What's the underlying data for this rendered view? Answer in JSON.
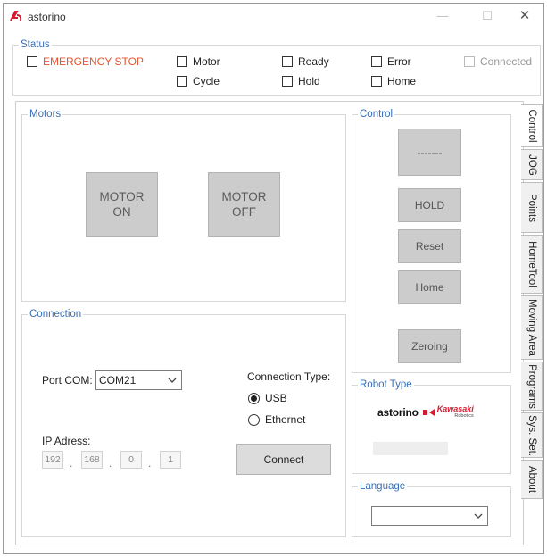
{
  "window": {
    "title": "astorino",
    "minimize": "—",
    "maximize": "☐",
    "close": "✕"
  },
  "status": {
    "legend": "Status",
    "emergency_stop": "EMERGENCY STOP",
    "motor": "Motor",
    "cycle": "Cycle",
    "ready": "Ready",
    "hold": "Hold",
    "error": "Error",
    "home": "Home",
    "connected": "Connected"
  },
  "motors": {
    "legend": "Motors",
    "on_line1": "MOTOR",
    "on_line2": "ON",
    "off_line1": "MOTOR",
    "off_line2": "OFF"
  },
  "control": {
    "legend": "Control",
    "top_button": "-------",
    "hold": "HOLD",
    "reset": "Reset",
    "home": "Home",
    "zeroing": "Zeroing"
  },
  "connection": {
    "legend": "Connection",
    "port_label": "Port COM:",
    "port_value": "COM21",
    "type_label": "Connection Type:",
    "usb": "USB",
    "ethernet": "Ethernet",
    "usb_selected": true,
    "ip_label": "IP Adress:",
    "ip": [
      "192",
      "168",
      "0",
      "1"
    ],
    "connect_button": "Connect"
  },
  "robot_type": {
    "legend": "Robot Type",
    "brand": "astorino",
    "maker": "Kawasaki",
    "maker_sub": "Robotics"
  },
  "language": {
    "legend": "Language",
    "value": ""
  },
  "tabs": [
    "Control",
    "JOG",
    "Points",
    "HomeTool",
    "Moving Area",
    "Programs",
    "Sys. Set.",
    "About"
  ],
  "colors": {
    "accent": "#3a6fb4",
    "estop": "#e8542d",
    "button": "#cccccc",
    "brand_red": "#d7192d"
  }
}
